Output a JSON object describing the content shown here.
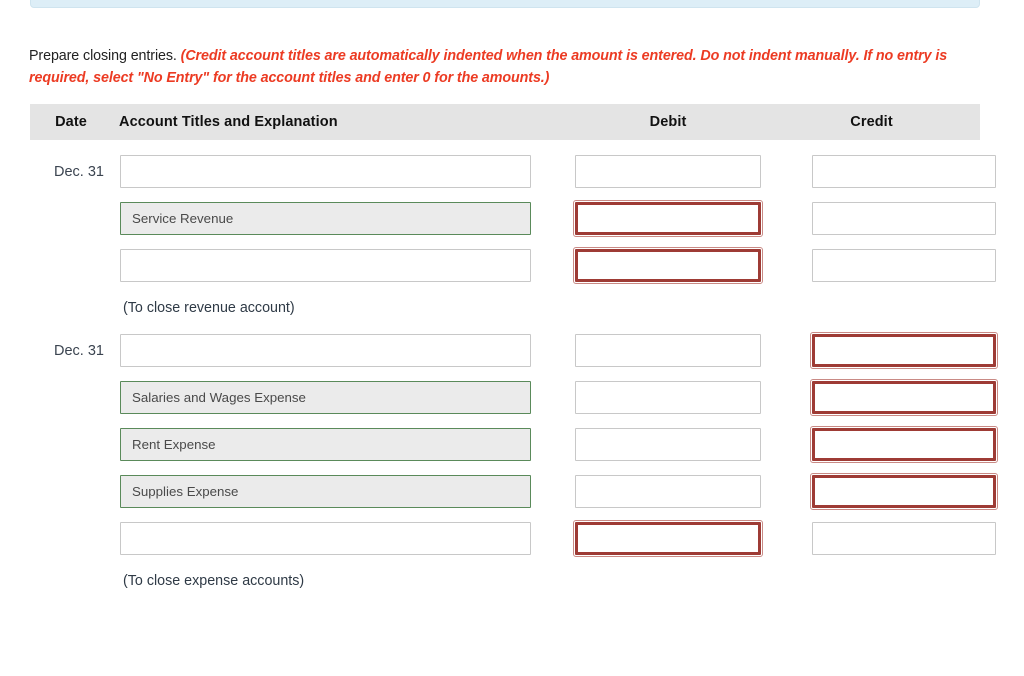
{
  "instructions": {
    "lead": "Prepare closing entries.",
    "hint": "(Credit account titles are automatically indented when the amount is entered. Do not indent manually. If no entry is required, select \"No Entry\" for the account titles and enter 0 for the amounts.)"
  },
  "table": {
    "headers": {
      "date": "Date",
      "account": "Account Titles and Explanation",
      "debit": "Debit",
      "credit": "Credit"
    },
    "rows": [
      {
        "date": "Dec. 31",
        "account": "",
        "account_state": "empty",
        "debit": "",
        "debit_state": "normal",
        "credit": "",
        "credit_state": "normal"
      },
      {
        "date": "",
        "account": "Service Revenue",
        "account_state": "filled",
        "debit": "",
        "debit_state": "flagged",
        "credit": "",
        "credit_state": "normal"
      },
      {
        "date": "",
        "account": "",
        "account_state": "empty",
        "debit": "",
        "debit_state": "flagged",
        "credit": "",
        "credit_state": "normal"
      },
      {
        "caption": "(To close revenue account)"
      },
      {
        "date": "Dec. 31",
        "account": "",
        "account_state": "empty",
        "debit": "",
        "debit_state": "normal",
        "credit": "",
        "credit_state": "flagged"
      },
      {
        "date": "",
        "account": "Salaries and Wages Expense",
        "account_state": "filled",
        "debit": "",
        "debit_state": "normal",
        "credit": "",
        "credit_state": "flagged"
      },
      {
        "date": "",
        "account": "Rent Expense",
        "account_state": "filled",
        "debit": "",
        "debit_state": "normal",
        "credit": "",
        "credit_state": "flagged"
      },
      {
        "date": "",
        "account": "Supplies Expense",
        "account_state": "filled",
        "debit": "",
        "debit_state": "normal",
        "credit": "",
        "credit_state": "flagged"
      },
      {
        "date": "",
        "account": "",
        "account_state": "empty",
        "debit": "",
        "debit_state": "flagged",
        "credit": "",
        "credit_state": "normal"
      },
      {
        "caption": "(To close expense accounts)"
      }
    ]
  },
  "colors": {
    "hint_red": "#ec3b23",
    "flag_red": "#9e3b35",
    "correct_green": "#5a8a5a",
    "header_gray": "#e4e4e4",
    "info_blue": "#ddeef7"
  }
}
